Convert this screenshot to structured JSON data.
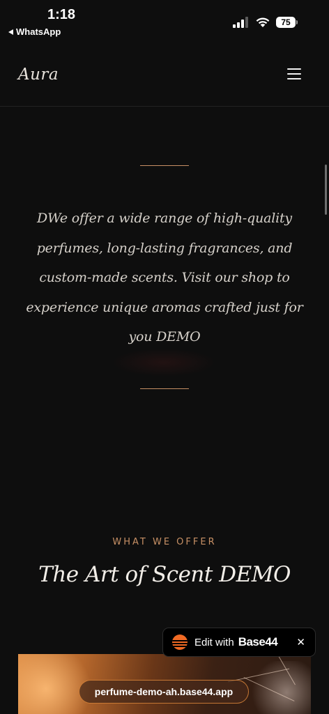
{
  "status_bar": {
    "time": "1:18",
    "back_app": "WhatsApp",
    "battery": "75"
  },
  "header": {
    "brand": "Aura",
    "menu_icon": "hamburger-menu-icon"
  },
  "intro": {
    "text": "DWe offer a wide range of high-quality perfumes, long-lasting fragrances, and custom-made scents. Visit our shop to experience unique aromas crafted just for you DEMO"
  },
  "offer": {
    "eyebrow": "WHAT WE OFFER",
    "title": "The Art of Scent DEMO"
  },
  "badge": {
    "edit_label": "Edit with",
    "brand": "Base44",
    "close": "✕"
  },
  "browser": {
    "url": "perfume-demo-ah.base44.app"
  },
  "colors": {
    "background": "#0e0e0e",
    "accent_gold": "#c79065",
    "base44_orange": "#f06a24"
  }
}
